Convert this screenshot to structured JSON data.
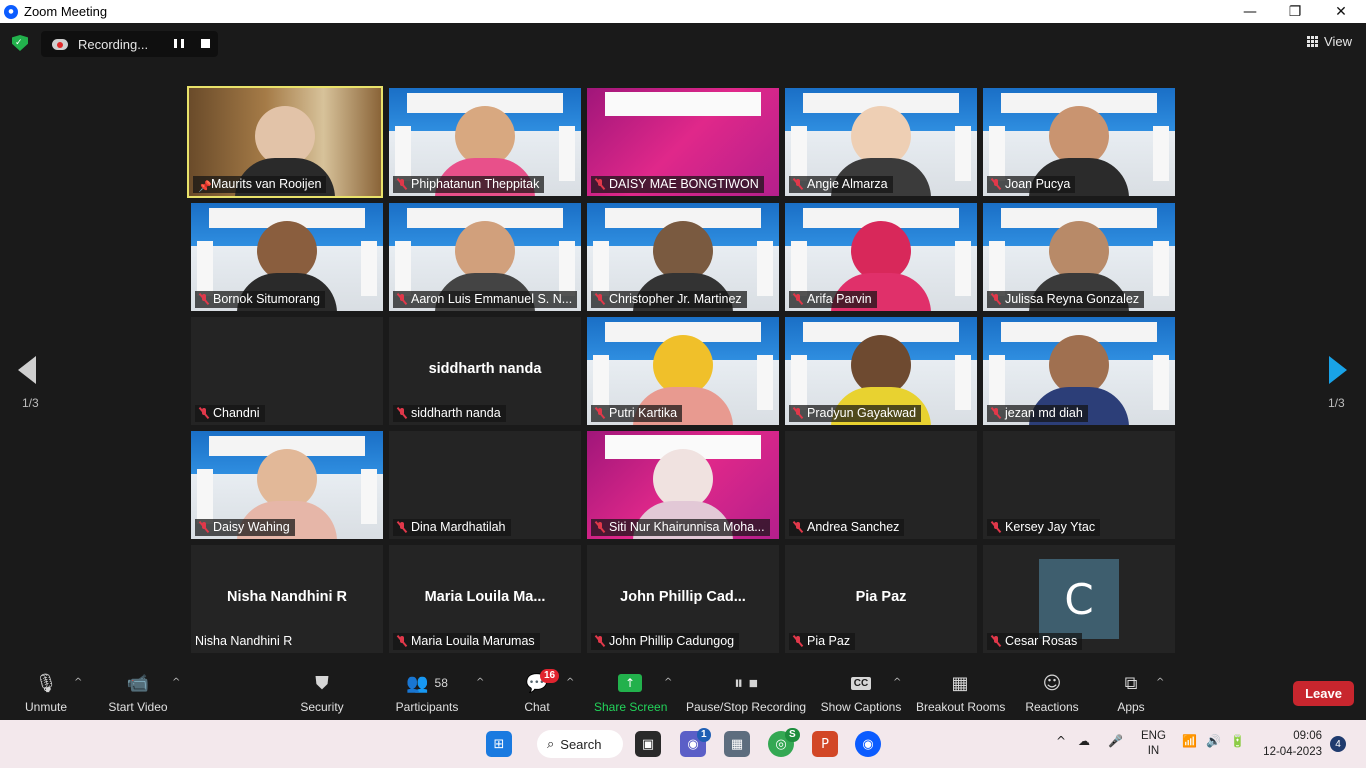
{
  "window": {
    "title": "Zoom Meeting",
    "minimize": "—",
    "maximize": "❐",
    "close": "✕"
  },
  "topbar": {
    "recording_label": "Recording...",
    "view_label": "View"
  },
  "pagination": {
    "left": "1/3",
    "right": "1/3"
  },
  "tiles": [
    {
      "name": "Maurits van Rooijen"
    },
    {
      "name": "Phiphatanun Theppitak"
    },
    {
      "name": "DAISY MAE BONGTIWON"
    },
    {
      "name": "Angie Almarza"
    },
    {
      "name": "Joan Pucya"
    },
    {
      "name": "Bornok Situmorang"
    },
    {
      "name": "Aaron Luis Emmanuel S. N..."
    },
    {
      "name": "Christopher Jr. Martinez"
    },
    {
      "name": "Arifa Parvin"
    },
    {
      "name": "Julissa Reyna Gonzalez"
    },
    {
      "name": "Chandni"
    },
    {
      "name": "siddharth nanda",
      "center": "siddharth nanda"
    },
    {
      "name": "Putri Kartika"
    },
    {
      "name": "Pradyun Gayakwad"
    },
    {
      "name": "jezan md diah"
    },
    {
      "name": "Daisy Wahing"
    },
    {
      "name": "Dina Mardhatilah"
    },
    {
      "name": "Siti Nur Khairunnisa Moha..."
    },
    {
      "name": "Andrea Sanchez"
    },
    {
      "name": "Kersey Jay Ytac"
    },
    {
      "name": "Nisha Nandhini R",
      "center": "Nisha Nandhini R"
    },
    {
      "name": "Maria Louila Marumas",
      "center": "Maria  Louila  Ma..."
    },
    {
      "name": "John Phillip Cadungog",
      "center": "John  Phillip  Cad..."
    },
    {
      "name": "Pia Paz",
      "center": "Pia Paz"
    },
    {
      "name": "Cesar Rosas",
      "avatar": "C"
    }
  ],
  "controls": {
    "unmute": "Unmute",
    "start_video": "Start Video",
    "security": "Security",
    "participants": "Participants",
    "participants_count": "58",
    "chat": "Chat",
    "chat_badge": "16",
    "share_screen": "Share Screen",
    "pause_stop": "Pause/Stop Recording",
    "show_captions": "Show Captions",
    "captions_icon": "CC",
    "breakout_rooms": "Breakout Rooms",
    "reactions": "Reactions",
    "apps": "Apps",
    "leave": "Leave"
  },
  "taskbar": {
    "search_label": "Search",
    "meet_badge": "1",
    "chrome_badge": "S",
    "lang_line1": "ENG",
    "lang_line2": "IN",
    "time": "09:06",
    "date": "12-04-2023",
    "notifications": "4"
  },
  "colors": {
    "active_speaker_border": "#e9e26a",
    "leave_button": "#c8262e",
    "share_screen_green": "#22b14c",
    "muted_red": "#e0384a",
    "next_arrow": "#19a3e8"
  }
}
